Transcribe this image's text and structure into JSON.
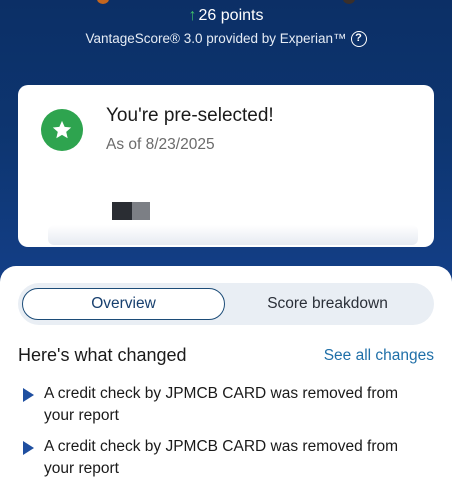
{
  "score": {
    "points_change": "26 points",
    "provider": "VantageScore® 3.0 provided by Experian™"
  },
  "card": {
    "title": "You're pre-selected!",
    "date": "As of 8/23/2025"
  },
  "tabs": {
    "overview": "Overview",
    "breakdown": "Score breakdown",
    "active": "Overview"
  },
  "changes": {
    "heading": "Here's what changed",
    "see_all": "See all changes",
    "items": [
      {
        "text": "A credit check by JPMCB CARD was removed from your report"
      },
      {
        "text": "A credit check by JPMCB CARD was removed from your report"
      }
    ]
  },
  "colors": {
    "hero_bg": "#0d3570",
    "accent_green": "#2ea44f",
    "link_blue": "#1f6fa8",
    "triangle_blue": "#1f4fa0"
  },
  "icons": {
    "points_arrow": "up-arrow-icon",
    "help": "help-circle-icon",
    "badge": "star-icon",
    "bullet": "triangle-right-icon"
  }
}
